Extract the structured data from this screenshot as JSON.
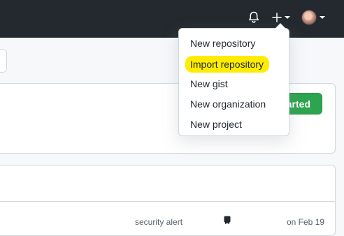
{
  "header": {
    "notifications_icon": "bell-icon",
    "create_icon": "plus-icon",
    "profile_icon": "avatar"
  },
  "create_menu": {
    "items": [
      {
        "label": "New repository",
        "highlighted": false
      },
      {
        "label": "Import repository",
        "highlighted": true,
        "highlight_color": "#ffec00"
      },
      {
        "label": "New gist",
        "highlighted": false
      },
      {
        "label": "New organization",
        "highlighted": false
      },
      {
        "label": "New project",
        "highlighted": false
      }
    ]
  },
  "main": {
    "primary_button_label": "arted",
    "primary_button_color": "#2da44e",
    "row": {
      "alert_text": "security alert",
      "date_text": "on Feb 19"
    }
  }
}
